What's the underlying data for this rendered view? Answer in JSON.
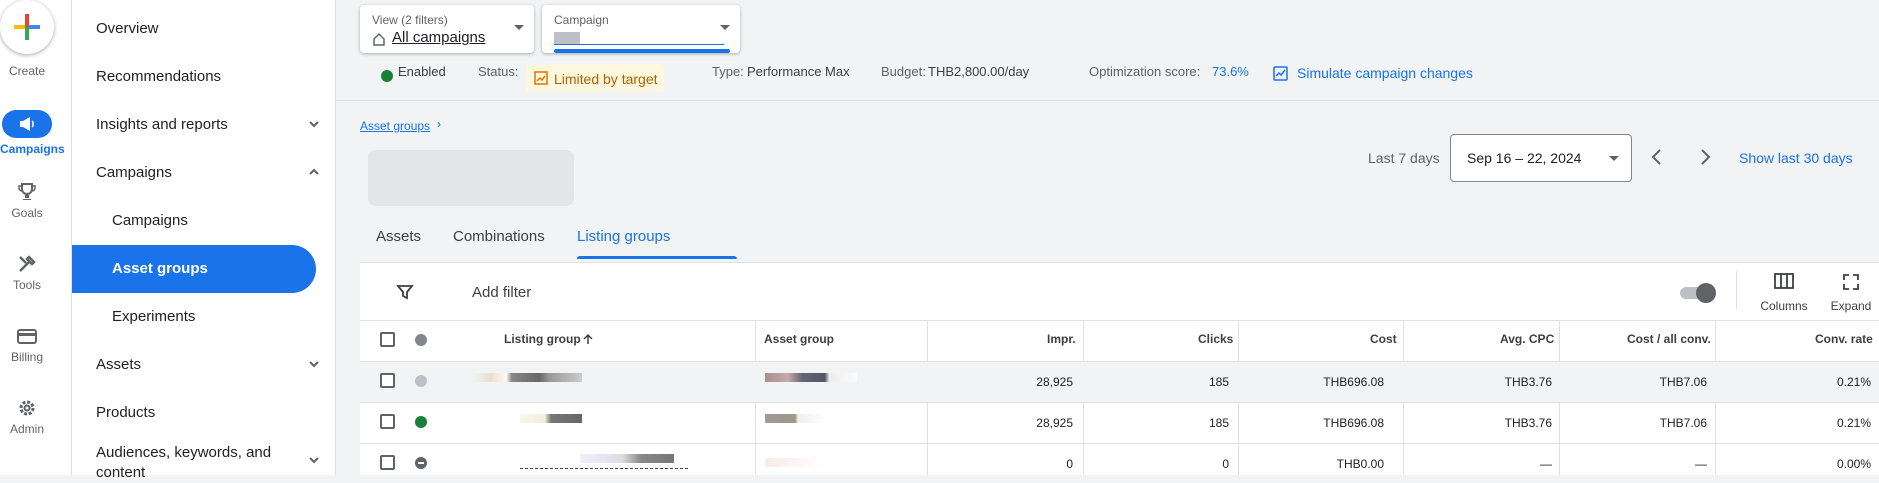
{
  "rail": {
    "create_label": "Create",
    "items": [
      {
        "label": "Campaigns",
        "icon": "megaphone-icon",
        "active": true
      },
      {
        "label": "Goals",
        "icon": "trophy-icon"
      },
      {
        "label": "Tools",
        "icon": "tools-icon"
      },
      {
        "label": "Billing",
        "icon": "credit-card-icon"
      },
      {
        "label": "Admin",
        "icon": "gear-icon"
      }
    ]
  },
  "subnav": {
    "overview": "Overview",
    "recommendations": "Recommendations",
    "insights": "Insights and reports",
    "campaigns": "Campaigns",
    "campaigns_sub": "Campaigns",
    "asset_groups": "Asset groups",
    "experiments": "Experiments",
    "assets": "Assets",
    "products": "Products",
    "audiences_line1": "Audiences, keywords, and",
    "audiences_line2": "content"
  },
  "header": {
    "view_small": "View (2 filters)",
    "view_value": "All campaigns",
    "campaign_small": "Campaign",
    "enabled": "Enabled",
    "status_label": "Status:",
    "status_value": "Limited by target",
    "type_label": "Type:",
    "type_value": "Performance Max",
    "budget_label": "Budget:",
    "budget_value": "THB2,800.00/day",
    "opt_label": "Optimization score:",
    "opt_value": "73.6%",
    "simulate": "Simulate campaign changes"
  },
  "breadcrumb": "Asset groups",
  "date": {
    "last_label": "Last 7 days",
    "range": "Sep 16 – 22, 2024",
    "show_last": "Show last 30 days"
  },
  "tabs": [
    "Assets",
    "Combinations",
    "Listing groups"
  ],
  "toolbar": {
    "add_filter": "Add filter",
    "columns": "Columns",
    "expand": "Expand"
  },
  "table": {
    "headers": {
      "listing_group": "Listing group",
      "asset_group": "Asset group",
      "impr": "Impr.",
      "clicks": "Clicks",
      "cost": "Cost",
      "avg_cpc": "Avg. CPC",
      "cost_conv": "Cost / all conv.",
      "conv_rate": "Conv. rate"
    },
    "rows": [
      {
        "impr": "28,925",
        "clicks": "185",
        "cost": "THB696.08",
        "avg_cpc": "THB3.76",
        "cost_conv": "THB7.06",
        "conv_rate": "0.21%"
      },
      {
        "impr": "28,925",
        "clicks": "185",
        "cost": "THB696.08",
        "avg_cpc": "THB3.76",
        "cost_conv": "THB7.06",
        "conv_rate": "0.21%"
      },
      {
        "impr": "0",
        "clicks": "0",
        "cost": "THB0.00",
        "avg_cpc": "—",
        "cost_conv": "—",
        "conv_rate": "0.00%"
      }
    ]
  },
  "colors": {
    "accent": "#1a73e8",
    "enabled": "#188038",
    "warning": "#fef7e0"
  }
}
